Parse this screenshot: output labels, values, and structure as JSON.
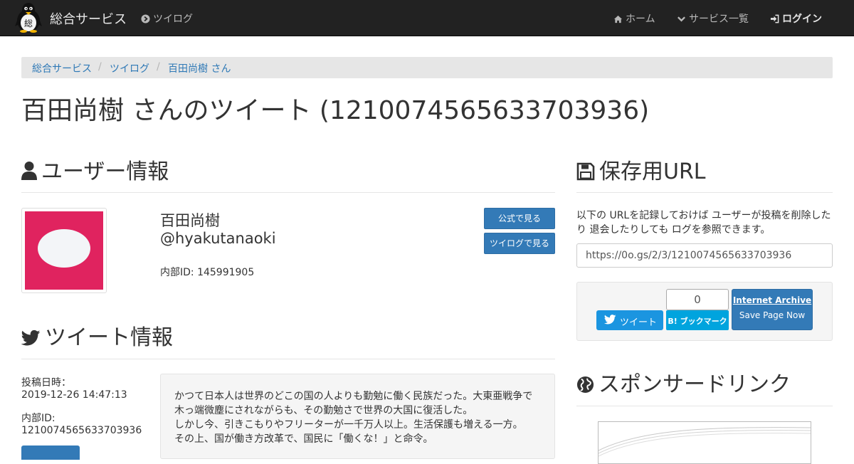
{
  "navbar": {
    "brand": "総合サービス",
    "logo_text": "総",
    "tsuilog": "ツイログ",
    "home": "ホーム",
    "services": "サービス一覧",
    "login": "ログイン"
  },
  "breadcrumb": [
    "総合サービス",
    "ツイログ",
    "百田尚樹 さん"
  ],
  "breadcrumb_separator": "/",
  "page_title": "百田尚樹 さんのツイート (1210074565633703936)",
  "user_section": {
    "heading": "ユーザー情報",
    "name": "百田尚樹",
    "handle": "@hyakutanaoki",
    "internal_id": "内部ID: 145991905",
    "btn_official": "公式で見る",
    "btn_tsuilog": "ツイログで見る",
    "avatar_color": "#e0235f"
  },
  "tweet_section": {
    "heading": "ツイート情報",
    "posted_label": "投稿日時：",
    "posted_value": "2019-12-26 14:47:13",
    "id_label": "内部ID:",
    "id_value": "1210074565633703936",
    "text_lines": [
      "かつて日本人は世界のどこの国の人よりも勤勉に働く民族だった。大東亜戦争で",
      "木っ端微塵にされながらも、その勤勉さで世界の大国に復活した。",
      "しかし今、引きこもりやフリーターが一千万人以上。生活保護も増える一方。",
      "その上、国が働き方改革で、国民に「働くな！」と命令。"
    ]
  },
  "archive_section": {
    "heading": "保存用URL",
    "description": "以下の URLを記録しておけば ユーザーが投稿を削除したり 退会したりしても ログを参照できます。",
    "url": "https://0o.gs/2/3/1210074565633703936",
    "tweet_btn": "ツイート",
    "hatena_count": "0",
    "hatena_btn": "B! ブックマーク",
    "ia_title": "Internet Archive",
    "ia_sub": "Save Page Now"
  },
  "sponsor_section": {
    "heading": "スポンサードリンク"
  },
  "colors": {
    "navbar": "#222222",
    "link": "#2f79b6",
    "primary_button": "#337ab7",
    "twitter": "#1b95e0",
    "hatena": "#00a4de"
  }
}
